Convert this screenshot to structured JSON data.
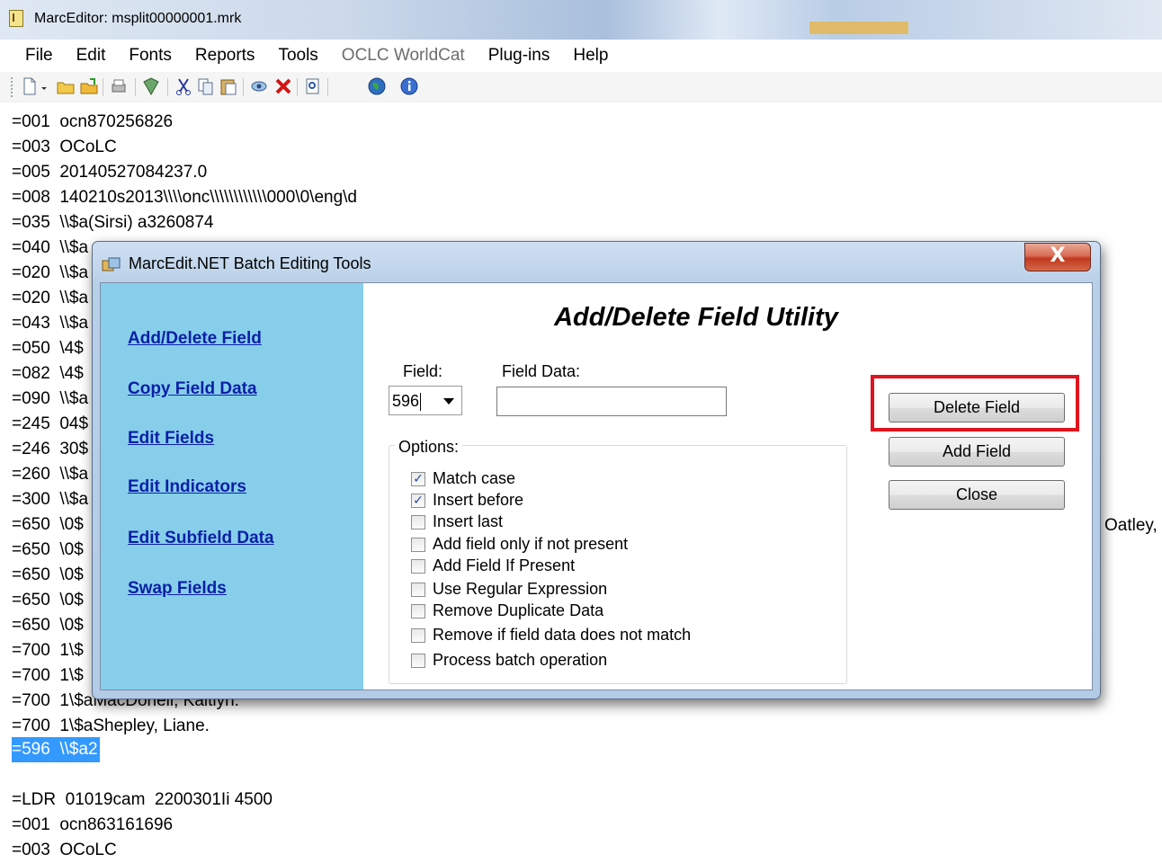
{
  "window": {
    "title": "MarcEditor: msplit00000001.mrk"
  },
  "menu": [
    "File",
    "Edit",
    "Fonts",
    "Reports",
    "Tools",
    "OCLC WorldCat",
    "Plug-ins",
    "Help"
  ],
  "menu_disabled": [
    "OCLC WorldCat"
  ],
  "toolbar": {
    "icons": [
      "new-file-icon",
      "dropdown-arrow-icon",
      "open-folder-icon",
      "open-file-icon",
      "print-icon",
      "validate-icon",
      "cut-icon",
      "copy-icon",
      "paste-icon",
      "preview-icon",
      "delete-icon",
      "find-icon",
      "globe-icon",
      "info-icon"
    ]
  },
  "editor": {
    "lines": [
      "=001  ocn870256826",
      "=003  OCoLC",
      "=005  20140527084237.0",
      "=008  140210s2013\\\\\\\\onc\\\\\\\\\\\\\\\\\\\\\\\\000\\0\\eng\\d",
      "=035  \\\\$a(Sirsi) a3260874",
      "=040  \\\\$a",
      "=020  \\\\$a",
      "=020  \\\\$a",
      "=043  \\\\$a",
      "=050  \\4$",
      "=082  \\4$",
      "=090  \\\\$a",
      "=245  04$",
      "=246  30$",
      "=260  \\\\$a",
      "=300  \\\\$a",
      "=650  \\0$",
      "=650  \\0$",
      "=650  \\0$",
      "=650  \\0$",
      "=650  \\0$",
      "=700  1\\$",
      "=700  1\\$",
      "=700  1\\$aMacDonell, Kaitlyn.",
      "=700  1\\$aShepley, Liane.",
      "=596  \\\\$a2",
      "",
      "=LDR  01019cam  2200301Ii 4500",
      "=001  ocn863161696",
      "=003  OCoLC"
    ],
    "selected_line": "=596  \\\\$a2",
    "right_fragment": "Oatley,"
  },
  "dialog": {
    "title": "MarcEdit.NET Batch Editing Tools",
    "close_label": "X",
    "nav": [
      "Add/Delete Field",
      "Copy Field Data",
      "Edit Fields",
      "Edit Indicators",
      "Edit Subfield Data",
      "Swap Fields"
    ],
    "heading": "Add/Delete Field Utility",
    "field_label": "Field:",
    "field_value": "596",
    "field_data_label": "Field Data:",
    "field_data_value": "",
    "options_label": "Options:",
    "options": [
      {
        "label": "Match case",
        "checked": true
      },
      {
        "label": "Insert before",
        "checked": true
      },
      {
        "label": "Insert last",
        "checked": false
      },
      {
        "label": "Add field only if not present",
        "checked": false
      },
      {
        "label": "Add Field If Present",
        "checked": false
      },
      {
        "label": "Use Regular Expression",
        "checked": false
      },
      {
        "label": "Remove Duplicate Data",
        "checked": false
      },
      {
        "label": "Remove if field data does not match",
        "checked": false
      },
      {
        "label": "Process batch operation",
        "checked": false
      }
    ],
    "buttons": {
      "delete": "Delete Field",
      "add": "Add Field",
      "close": "Close"
    },
    "highlight_color": "#e0141e"
  }
}
